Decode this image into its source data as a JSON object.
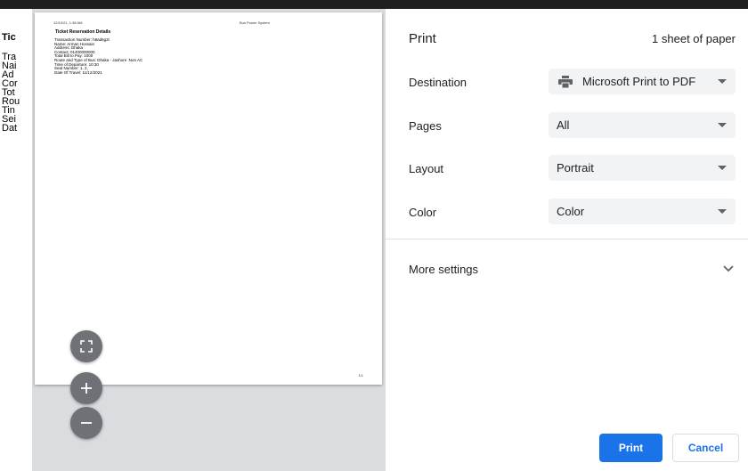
{
  "background_page": {
    "title_fragment": "Tic",
    "line_fragments": [
      "Tra",
      "Nai",
      "Ad",
      "Cor",
      "Tot",
      "Rou",
      "Tin",
      "Sei",
      "Dat"
    ]
  },
  "preview": {
    "header_date": "12/10/21, 1:38 AM",
    "header_app": "Bus Power System",
    "doc_title": "Ticket Reservation Details",
    "lines": [
      "Transaction Number: h8ad6g3i",
      "Name: Arman Hossain",
      "Address: Dhaka",
      "Contact: 01400000000",
      "Total Bill to Pay: 1000",
      "Route and Type of Bus: Dhaka - Jashore :Non AC",
      "Time of Departure: 10:30",
      "Seat Number: 1, 2,",
      "Date Of Travel: 11/12/2021"
    ],
    "page_number": "1/1",
    "controls": {
      "fit_icon": "fit-to-page-icon",
      "zoom_in_icon": "plus-icon",
      "zoom_out_icon": "minus-icon"
    }
  },
  "panel": {
    "title": "Print",
    "sheet_count": "1 sheet of paper",
    "destination": {
      "label": "Destination",
      "value": "Microsoft Print to PDF",
      "icon": "printer-icon"
    },
    "pages": {
      "label": "Pages",
      "value": "All"
    },
    "layout": {
      "label": "Layout",
      "value": "Portrait"
    },
    "color": {
      "label": "Color",
      "value": "Color"
    },
    "more_settings": {
      "label": "More settings",
      "icon": "chevron-down-icon"
    },
    "print_button": "Print",
    "cancel_button": "Cancel"
  },
  "colors": {
    "accent": "#1a73e8",
    "preview_bg": "#dadce0",
    "select_bg": "#f1f3f4",
    "zoom_button": "#6e7175"
  }
}
